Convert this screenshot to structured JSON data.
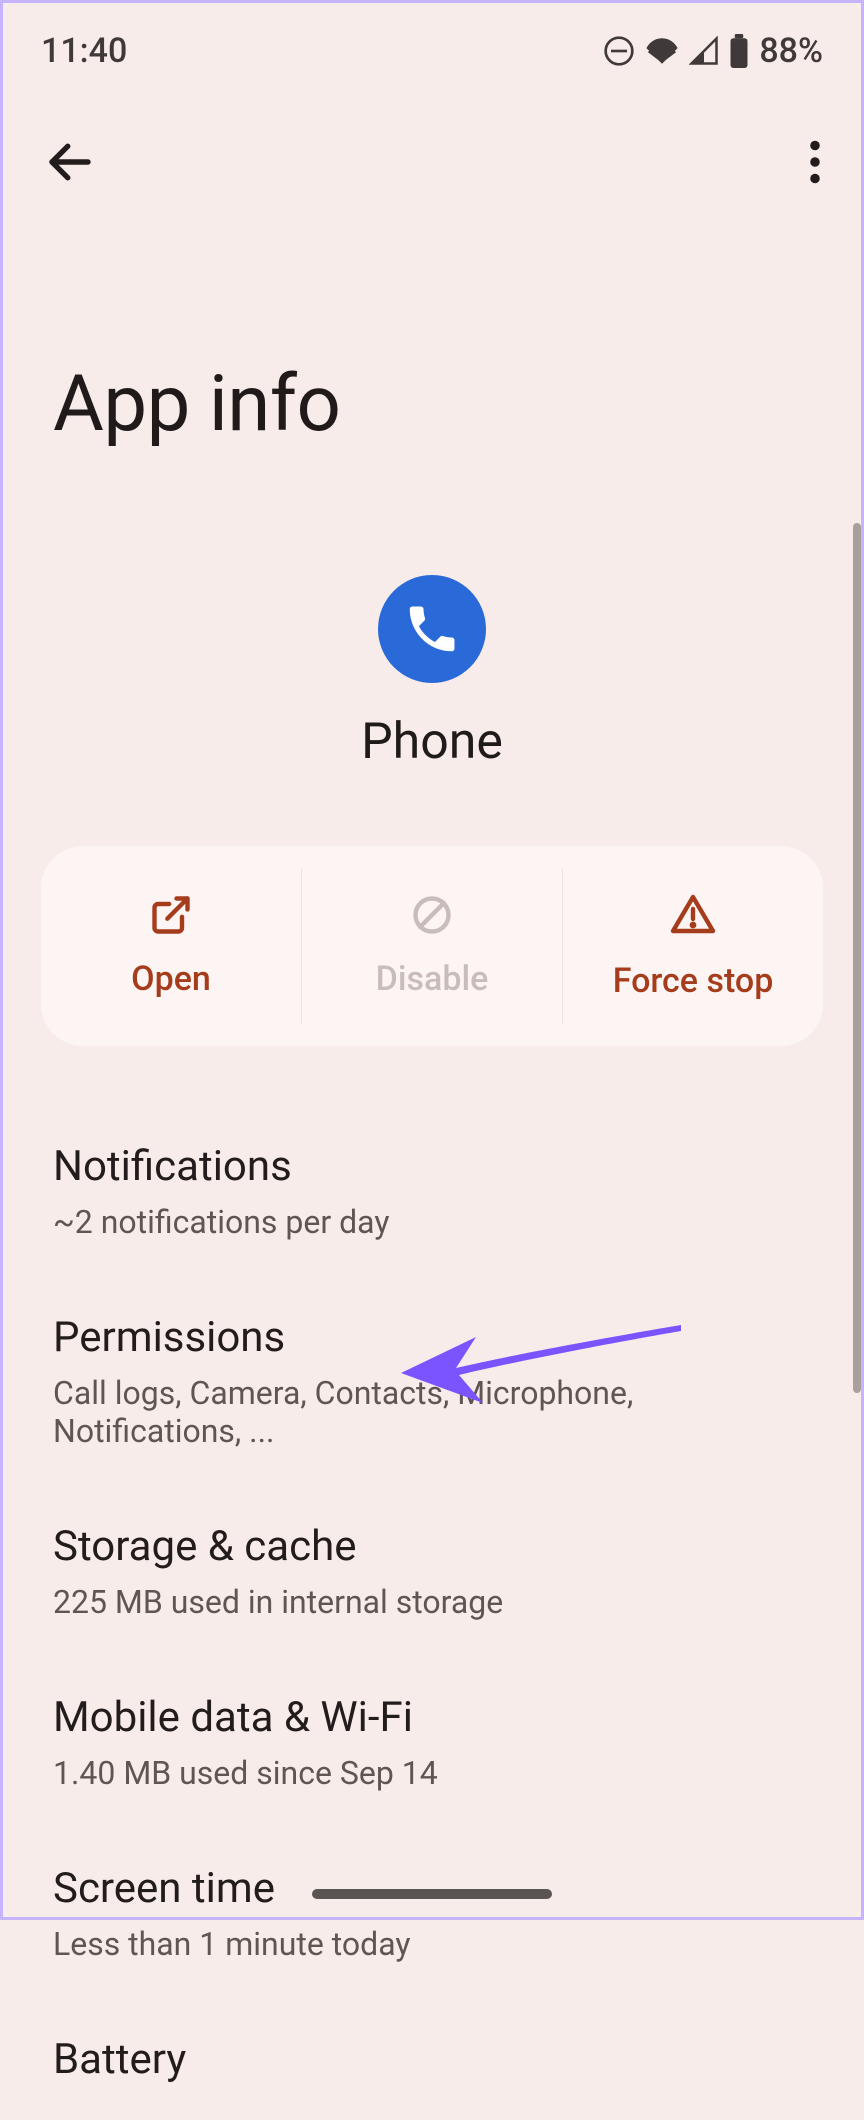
{
  "status": {
    "time": "11:40",
    "battery_pct": "88%"
  },
  "page": {
    "title": "App info"
  },
  "app": {
    "name": "Phone"
  },
  "actions": {
    "open": "Open",
    "disable": "Disable",
    "force_stop": "Force stop"
  },
  "items": [
    {
      "title": "Notifications",
      "subtitle": "~2 notifications per day"
    },
    {
      "title": "Permissions",
      "subtitle": "Call logs, Camera, Contacts, Microphone, Notifications, ..."
    },
    {
      "title": "Storage & cache",
      "subtitle": "225 MB used in internal storage"
    },
    {
      "title": "Mobile data & Wi-Fi",
      "subtitle": "1.40 MB used since Sep 14"
    },
    {
      "title": "Screen time",
      "subtitle": "Less than 1 minute today"
    },
    {
      "title": "Battery",
      "subtitle": ""
    }
  ]
}
